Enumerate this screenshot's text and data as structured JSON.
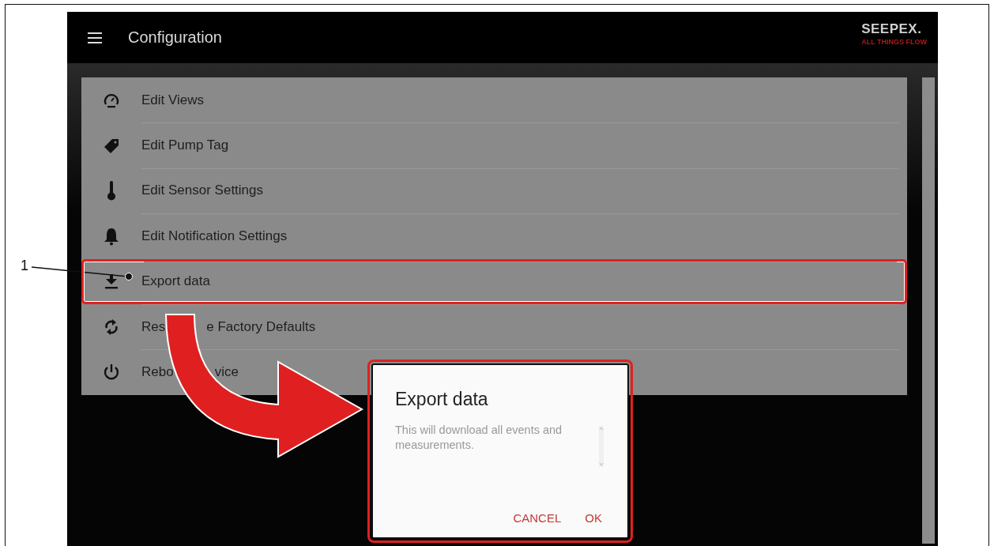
{
  "header": {
    "title": "Configuration",
    "brand": "SEEPEX.",
    "tagline": "ALL THINGS FLOW"
  },
  "menu": [
    {
      "label_parts": [
        "Edit Views"
      ],
      "highlighted": false
    },
    {
      "label_parts": [
        "Edit Pump Tag"
      ],
      "highlighted": false
    },
    {
      "label_parts": [
        "Edit Sensor Settings"
      ],
      "highlighted": false
    },
    {
      "label_parts": [
        "Edit Notification Settings"
      ],
      "highlighted": false
    },
    {
      "label_parts": [
        "Export data"
      ],
      "highlighted": true
    },
    {
      "label_parts": [
        "Res",
        "e Factory Defaults"
      ],
      "highlighted": false
    },
    {
      "label_parts": [
        "Rebo",
        "vice"
      ],
      "highlighted": false
    }
  ],
  "dialog": {
    "title": "Export data",
    "message": "This will download all events and measurements.",
    "buttons": [
      "CANCEL",
      "OK"
    ],
    "highlighted": true
  },
  "callouts": [
    {
      "label": "1"
    }
  ]
}
